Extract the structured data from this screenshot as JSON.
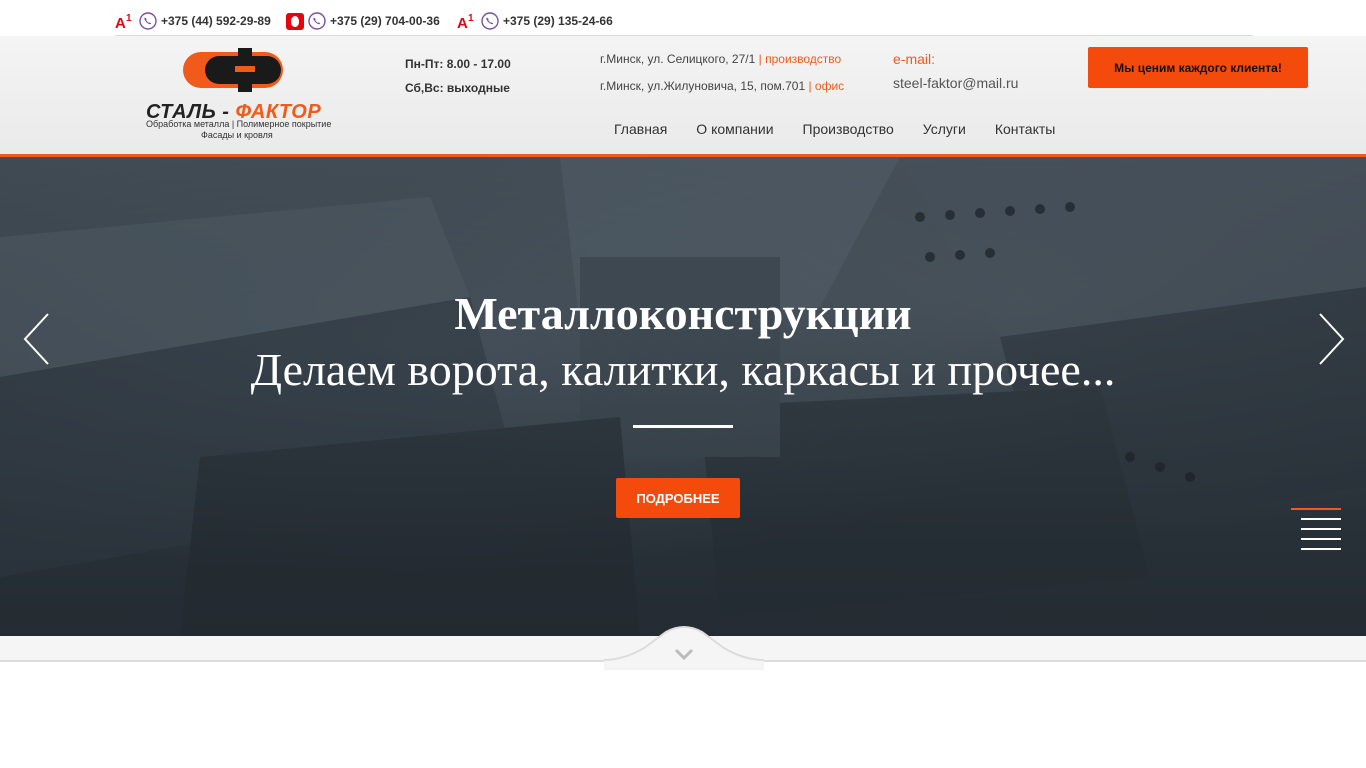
{
  "topbar": {
    "phones": [
      {
        "operator_icon": "a1-logo-icon",
        "number": "+375 (44) 592-29-89"
      },
      {
        "operator_icon": "mts-logo-icon",
        "number": "+375 (29) 704-00-36"
      },
      {
        "operator_icon": "a1-logo-icon",
        "number": "+375 (29) 135-24-66"
      }
    ],
    "messenger_icon": "viber-icon"
  },
  "logo": {
    "brand_left": "СТАЛЬ -",
    "brand_right": "ФАКТОР",
    "sub1": "Обработка металла    |    Полимерное покрытие",
    "sub2": "Фасады и кровля"
  },
  "hours": {
    "weekdays": "Пн-Пт: 8.00 - 17.00",
    "weekend": "Сб,Вс: выходные"
  },
  "addresses": [
    {
      "text": "г.Минск, ул. Селицкого, 27/1",
      "tag": "| производство"
    },
    {
      "text": "г.Минск, ул.Жилуновича, 15, пом.701",
      "tag": "| офис"
    }
  ],
  "email": {
    "label": "e-mail:",
    "value": "steel-faktor@mail.ru"
  },
  "cta_label": "Мы ценим каждого клиента!",
  "nav": [
    "Главная",
    "О компании",
    "Производство",
    "Услуги",
    "Контакты"
  ],
  "hero": {
    "title": "Металлоконструкции",
    "subtitle": "Делаем ворота, калитки, каркасы и прочее...",
    "button_label": "ПОДРОБНЕЕ"
  },
  "colors": {
    "accent": "#f44b0c",
    "header_line": "#f05a1a"
  }
}
